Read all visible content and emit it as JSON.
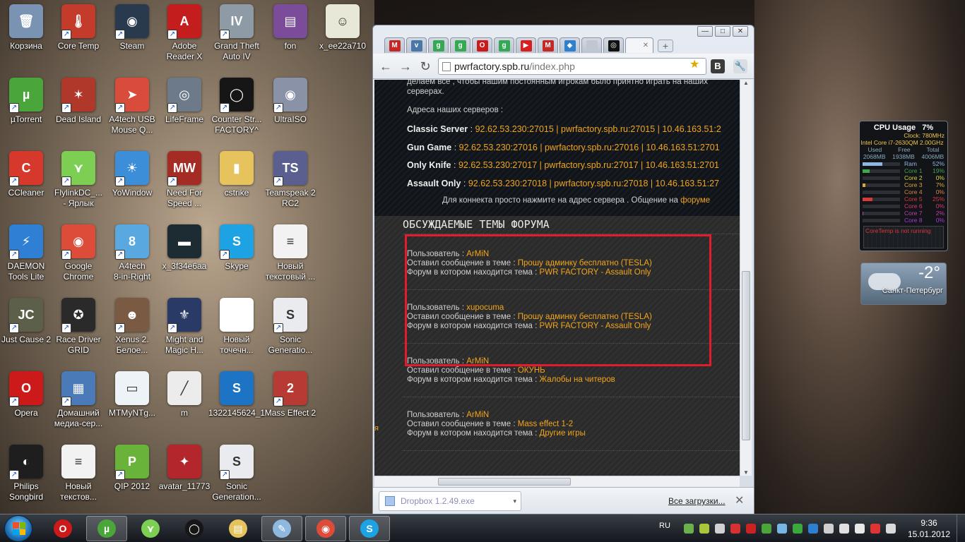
{
  "desktop": {
    "icons": [
      {
        "label": "Корзина",
        "icon": "recycle-bin-icon",
        "color": "#7a93b3",
        "glyph": "🗑",
        "shortcut": false
      },
      {
        "label": "Core Temp",
        "icon": "core-temp-icon",
        "color": "#c43b2b",
        "glyph": "🌡",
        "shortcut": true
      },
      {
        "label": "Steam",
        "icon": "steam-icon",
        "color": "#2a3a4e",
        "glyph": "◉",
        "shortcut": true
      },
      {
        "label": "Adobe\nReader X",
        "icon": "adobe-reader-icon",
        "color": "#c41d1d",
        "glyph": "A",
        "shortcut": true
      },
      {
        "label": "Grand Theft\nAuto IV",
        "icon": "gta-icon",
        "color": "#8e9aa6",
        "glyph": "IV",
        "shortcut": true
      },
      {
        "label": "fon",
        "icon": "archive-icon",
        "color": "#7a4c99",
        "glyph": "▤",
        "shortcut": false
      },
      {
        "label": "x_ee22a710",
        "icon": "image-file-icon",
        "color": "#e8e8d8",
        "glyph": "☺",
        "shortcut": false
      },
      {
        "label": "µTorrent",
        "icon": "utorrent-icon",
        "color": "#4aa53a",
        "glyph": "µ",
        "shortcut": true
      },
      {
        "label": "Dead Island",
        "icon": "dead-island-icon",
        "color": "#b0382a",
        "glyph": "✶",
        "shortcut": true
      },
      {
        "label": "A4tech USB\nMouse Q...",
        "icon": "a4tech-mouse-icon",
        "color": "#d94b3a",
        "glyph": "➤",
        "shortcut": true
      },
      {
        "label": "LifeFrame",
        "icon": "lifeframe-icon",
        "color": "#6c7a8a",
        "glyph": "◎",
        "shortcut": true
      },
      {
        "label": "Counter Str...\nFACTORY^",
        "icon": "counter-strike-icon",
        "color": "#161616",
        "glyph": "◯",
        "shortcut": true
      },
      {
        "label": "UltraISO",
        "icon": "ultraiso-icon",
        "color": "#8a92a8",
        "glyph": "◉",
        "shortcut": true
      },
      {
        "label": "CCleaner",
        "icon": "ccleaner-icon",
        "color": "#d6392b",
        "glyph": "C",
        "shortcut": true
      },
      {
        "label": "FlylinkDC_...\n- Ярлык",
        "icon": "flylink-icon",
        "color": "#7ccf53",
        "glyph": "⋎",
        "shortcut": true
      },
      {
        "label": "YoWindow",
        "icon": "yowindow-icon",
        "color": "#3d8ed8",
        "glyph": "☀",
        "shortcut": true
      },
      {
        "label": "Need For\nSpeed ...",
        "icon": "nfs-icon",
        "color": "#a52b25",
        "glyph": "MW",
        "shortcut": true
      },
      {
        "label": "cstrike",
        "icon": "folder-icon",
        "color": "#e6c35c",
        "glyph": "▮",
        "shortcut": false
      },
      {
        "label": "Teamspeak 2\nRC2",
        "icon": "teamspeak-icon",
        "color": "#5b5f8f",
        "glyph": "TS",
        "shortcut": true
      },
      {
        "label": "DAEMON\nTools Lite",
        "icon": "daemon-tools-icon",
        "color": "#2f7fd4",
        "glyph": "⚡",
        "shortcut": true
      },
      {
        "label": "Google\nChrome",
        "icon": "chrome-icon",
        "color": "#dd4b39",
        "glyph": "◉",
        "shortcut": true
      },
      {
        "label": "A4tech\n8-in-Right",
        "icon": "a4tech-8-icon",
        "color": "#59a8df",
        "glyph": "8",
        "shortcut": true
      },
      {
        "label": "x_3f34e6aa",
        "icon": "image-file-icon",
        "color": "#1d2b33",
        "glyph": "▬",
        "shortcut": false
      },
      {
        "label": "Skype",
        "icon": "skype-icon",
        "color": "#1da2e3",
        "glyph": "S",
        "shortcut": true
      },
      {
        "label": "Новый\nтекстовый ...",
        "icon": "text-file-icon",
        "color": "#f2f2f2",
        "glyph": "≡",
        "shortcut": false
      },
      {
        "label": "Just Cause 2",
        "icon": "just-cause-icon",
        "color": "#5c5f4a",
        "glyph": "JC",
        "shortcut": true
      },
      {
        "label": "Race Driver\nGRID",
        "icon": "grid-icon",
        "color": "#2a2a2a",
        "glyph": "✪",
        "shortcut": true
      },
      {
        "label": "Xenus 2.\nБелое...",
        "icon": "xenus-icon",
        "color": "#7b5a43",
        "glyph": "☻",
        "shortcut": true
      },
      {
        "label": "Might and\nMagic H...",
        "icon": "might-magic-icon",
        "color": "#2a3a66",
        "glyph": "⚜",
        "shortcut": true
      },
      {
        "label": "Новый\nточечн...",
        "icon": "bitmap-file-icon",
        "color": "#ffffff",
        "glyph": "",
        "shortcut": false
      },
      {
        "label": "Sonic\nGeneratio...",
        "icon": "sonic-icon",
        "color": "#e9ebee",
        "glyph": "S",
        "shortcut": true
      },
      {
        "label": "Opera",
        "icon": "opera-icon",
        "color": "#cc1a1a",
        "glyph": "O",
        "shortcut": true
      },
      {
        "label": "Домашний\nмедиа-сер...",
        "icon": "media-server-icon",
        "color": "#4a7bb8",
        "glyph": "▦",
        "shortcut": true
      },
      {
        "label": "MTMyNTg...",
        "icon": "image-file-icon",
        "color": "#eef3f8",
        "glyph": "▭",
        "shortcut": false
      },
      {
        "label": "m",
        "icon": "rifle-icon",
        "color": "#ececec",
        "glyph": "╱",
        "shortcut": false
      },
      {
        "label": "1322145624_1",
        "icon": "image-file-icon",
        "color": "#1d74c4",
        "glyph": "S",
        "shortcut": false
      },
      {
        "label": "Mass Effect 2",
        "icon": "mass-effect-icon",
        "color": "#b83a34",
        "glyph": "2",
        "shortcut": true
      },
      {
        "label": "Philips\nSongbird",
        "icon": "songbird-icon",
        "color": "#1e1e1e",
        "glyph": "◐",
        "shortcut": true
      },
      {
        "label": "Новый\nтекстов...",
        "icon": "text-file-icon",
        "color": "#f2f2f2",
        "glyph": "≡",
        "shortcut": false
      },
      {
        "label": "QIP 2012",
        "icon": "qip-icon",
        "color": "#69b33a",
        "glyph": "P",
        "shortcut": true
      },
      {
        "label": "avatar_11773",
        "icon": "image-file-icon",
        "color": "#b3262b",
        "glyph": "✦",
        "shortcut": false
      },
      {
        "label": "Sonic\nGeneration...",
        "icon": "sonic-icon",
        "color": "#e9ebee",
        "glyph": "S",
        "shortcut": true
      }
    ]
  },
  "browser": {
    "tabs": [
      {
        "icon": "mail-icon",
        "glyph": "M",
        "color": "#c62828"
      },
      {
        "icon": "vk-icon",
        "glyph": "v",
        "color": "#4a76a8"
      },
      {
        "icon": "google-icon",
        "glyph": "g",
        "color": "#34a853"
      },
      {
        "icon": "google-icon",
        "glyph": "g",
        "color": "#34a853"
      },
      {
        "icon": "opera-icon",
        "glyph": "O",
        "color": "#cc1a1a"
      },
      {
        "icon": "google-icon",
        "glyph": "g",
        "color": "#34a853"
      },
      {
        "icon": "youtube-icon",
        "glyph": "▶",
        "color": "#d81f1f"
      },
      {
        "icon": "mail-icon",
        "glyph": "M",
        "color": "#c62828"
      },
      {
        "icon": "dropbox-icon",
        "glyph": "◆",
        "color": "#2d7fd0"
      },
      {
        "icon": "blank-icon",
        "glyph": "",
        "color": "#c0c7d0"
      },
      {
        "icon": "pwrfactory-icon",
        "glyph": "◎",
        "color": "#111111"
      }
    ],
    "url": {
      "host": "pwrfactory.spb.ru",
      "path": "/index.php"
    },
    "download": {
      "filename": "Dropbox 1.2.49.exe",
      "all_label": "Все загрузки..."
    }
  },
  "page": {
    "intro": "делаем всё , чтобы нашим постоянным игрокам было приятно играть на наших\nсерверах.",
    "servers_title": "Адреса наших серверов :",
    "servers": [
      {
        "name": "Classic Server",
        "addr": "92.62.53.230:27015 | pwrfactory.spb.ru:27015 | 10.46.163.51:2"
      },
      {
        "name": "Gun Game",
        "addr": "92.62.53.230:27016 | pwrfactory.spb.ru:27016 | 10.46.163.51:2701"
      },
      {
        "name": "Only Knife",
        "addr": "92.62.53.230:27017 | pwrfactory.spb.ru:27017 | 10.46.163.51:2701"
      },
      {
        "name": "Assault Only",
        "addr": "92.62.53.230:27018 | pwrfactory.spb.ru:27018 | 10.46.163.51:27"
      }
    ],
    "connect_text": "Для коннекта просто нажмите на адрес сервера . Общение на",
    "connect_link": "форуме",
    "section_title": "ОБСУЖДАЕМЫЕ ТЕМЫ ФОРУМА",
    "user_label": "Пользователь :",
    "msg_label": "Оставил сообщение в теме :",
    "forum_label": "Форум в котором находится тема :",
    "posts": [
      {
        "user": "ArMiN",
        "topic": "Прошу админку бесплатно (TESLA)",
        "forum": "PWR FACTORY - Assault Only"
      },
      {
        "user": "xupocuma",
        "topic": "Прошу админку бесплатно (TESLA)",
        "forum": "PWR FACTORY - Assault Only"
      },
      {
        "user": "ArMiN",
        "topic": "ОКУНЬ",
        "forum": "Жалобы на читеров"
      },
      {
        "user": "ArMiN",
        "topic": "Mass effect 1-2",
        "forum": "Другие игры"
      }
    ],
    "side_text": "я"
  },
  "gadgets": {
    "cpu": {
      "title": "CPU Usage",
      "total": "7%",
      "clock_label": "Clock:",
      "clock": "780MHz",
      "model": "Intel Core i7-2630QM 2.00GHz",
      "mem_headers": [
        "Used",
        "Free",
        "Total"
      ],
      "mem_values": [
        "2068MB",
        "1938MB",
        "4006MB"
      ],
      "rows": [
        {
          "name": "Ram",
          "pct": "52%",
          "level": 52,
          "color": "#8fb7e2"
        },
        {
          "name": "Core 1",
          "pct": "19%",
          "level": 19,
          "color": "#3da84a"
        },
        {
          "name": "Core 2",
          "pct": "0%",
          "level": 0,
          "color": "#d8d83a"
        },
        {
          "name": "Core 3",
          "pct": "7%",
          "level": 7,
          "color": "#d8a83a"
        },
        {
          "name": "Core 4",
          "pct": "0%",
          "level": 0,
          "color": "#d88a3a"
        },
        {
          "name": "Core 5",
          "pct": "25%",
          "level": 25,
          "color": "#d83a3a"
        },
        {
          "name": "Core 6",
          "pct": "0%",
          "level": 0,
          "color": "#d83a6a"
        },
        {
          "name": "Core 7",
          "pct": "2%",
          "level": 2,
          "color": "#c83ab0"
        },
        {
          "name": "Core 8",
          "pct": "0%",
          "level": 0,
          "color": "#a83ad8"
        }
      ],
      "status": "CoreTemp is not running"
    },
    "weather": {
      "temp": "-2°",
      "city": "Санкт-Петербург"
    }
  },
  "taskbar": {
    "buttons": [
      {
        "icon": "opera-icon",
        "glyph": "O",
        "color": "#cc1a1a",
        "active": false
      },
      {
        "icon": "utorrent-icon",
        "glyph": "µ",
        "color": "#4aa53a",
        "active": true
      },
      {
        "icon": "flylink-icon",
        "glyph": "⋎",
        "color": "#7ccf53",
        "active": false
      },
      {
        "icon": "counter-strike-icon",
        "glyph": "◯",
        "color": "#161616",
        "active": false
      },
      {
        "icon": "explorer-icon",
        "glyph": "▤",
        "color": "#e6c35c",
        "active": false
      },
      {
        "icon": "notepad-icon",
        "glyph": "✎",
        "color": "#8fb8de",
        "active": true
      },
      {
        "icon": "chrome-icon",
        "glyph": "◉",
        "color": "#dd4b39",
        "active": true
      },
      {
        "icon": "skype-icon",
        "glyph": "S",
        "color": "#1da2e3",
        "active": true
      }
    ],
    "lang": "RU",
    "time": "9:36",
    "date": "15.01.2012"
  }
}
